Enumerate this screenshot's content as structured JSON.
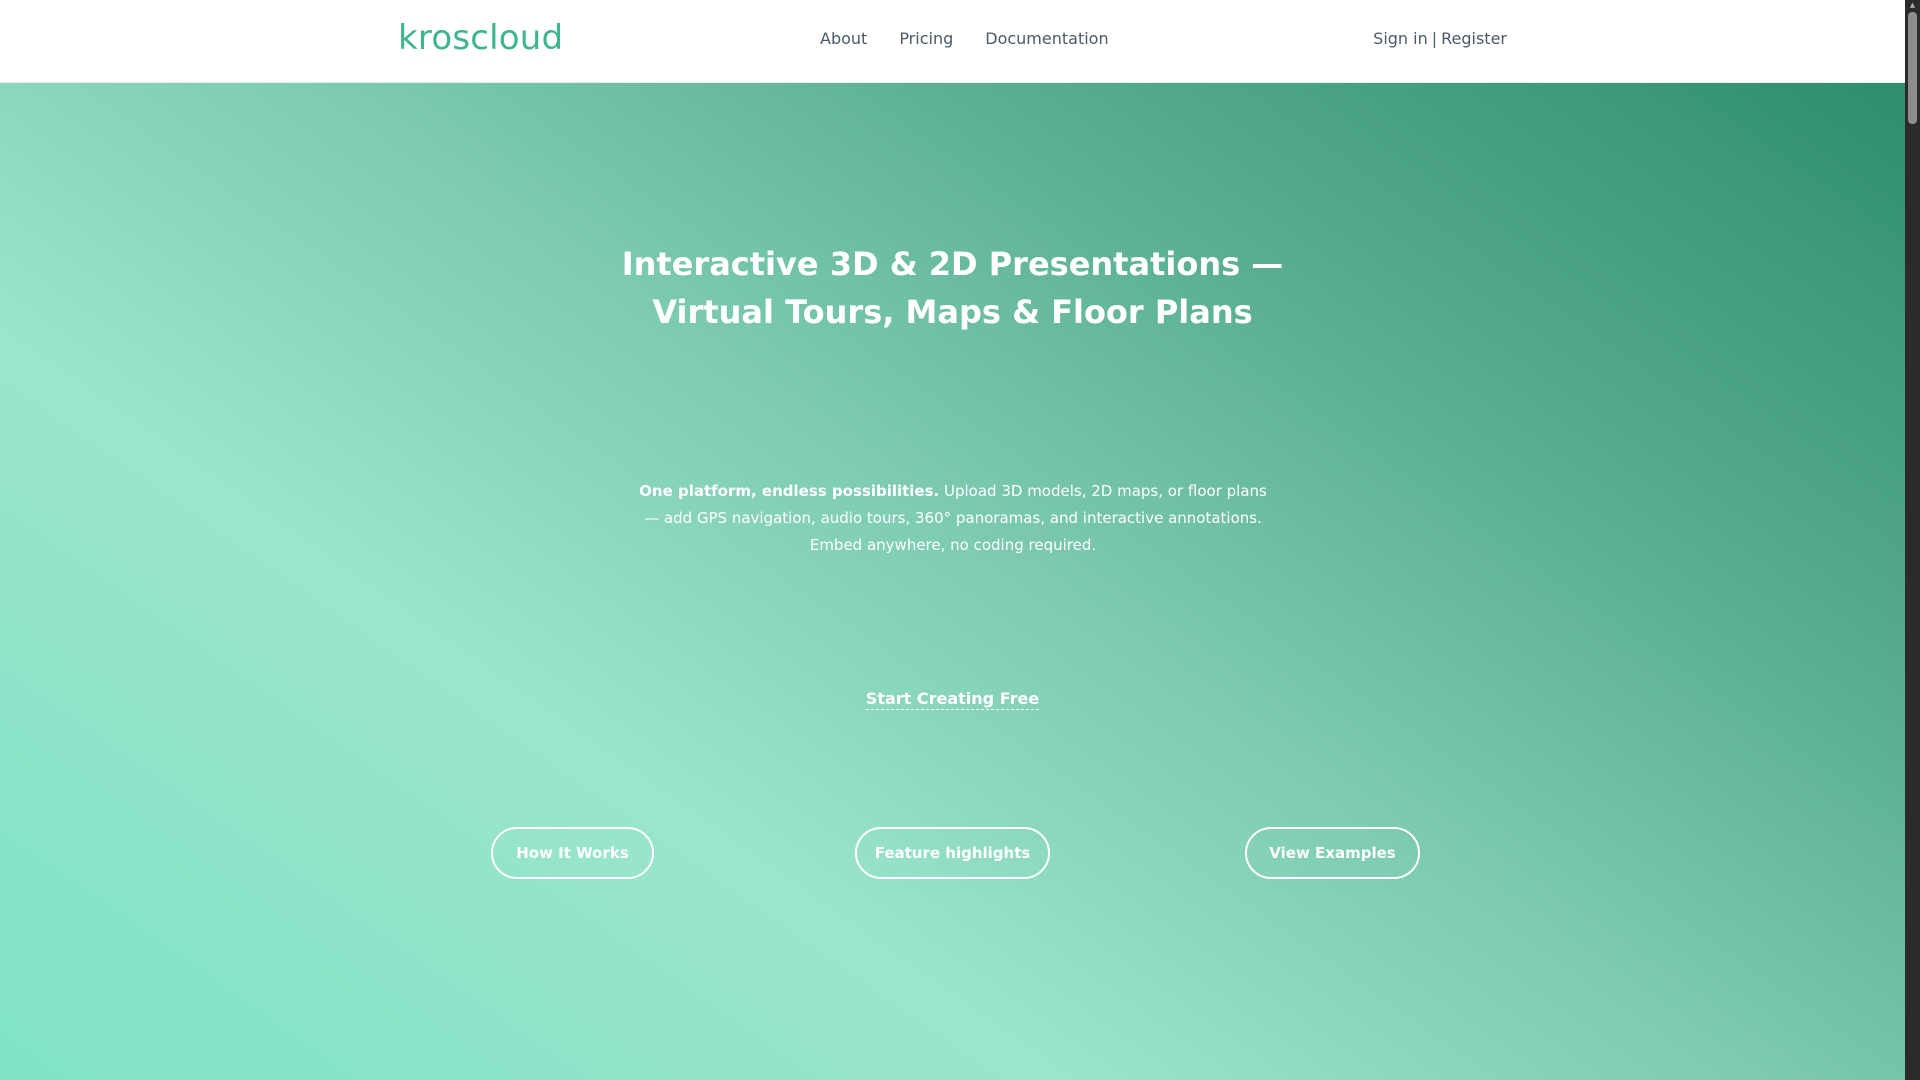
{
  "header": {
    "logo": "kroscloud",
    "nav": [
      "About",
      "Pricing",
      "Documentation"
    ],
    "auth": {
      "sign_in": "Sign in",
      "separator": "|",
      "register": "Register"
    }
  },
  "hero": {
    "title_line1": "Interactive 3D & 2D Presentations —",
    "title_line2": "Virtual Tours, Maps & Floor Plans",
    "description_bold": "One platform, endless possibilities.",
    "description_rest": " Upload 3D models, 2D maps, or floor plans — add GPS navigation, audio tours, 360° panoramas, and interactive annotations. Embed anywhere, no coding required.",
    "cta_link": "Start Creating Free",
    "buttons": {
      "how": "How It Works",
      "features": "Feature highlights",
      "examples": "View Examples"
    }
  },
  "colors": {
    "brand": "#3fb58b",
    "nav_text": "#4a5a6a",
    "hero_dark": "#2f8e6c",
    "hero_light": "#9be5cc"
  },
  "icons": {
    "scroll_up": "scroll-up-arrow-icon"
  }
}
